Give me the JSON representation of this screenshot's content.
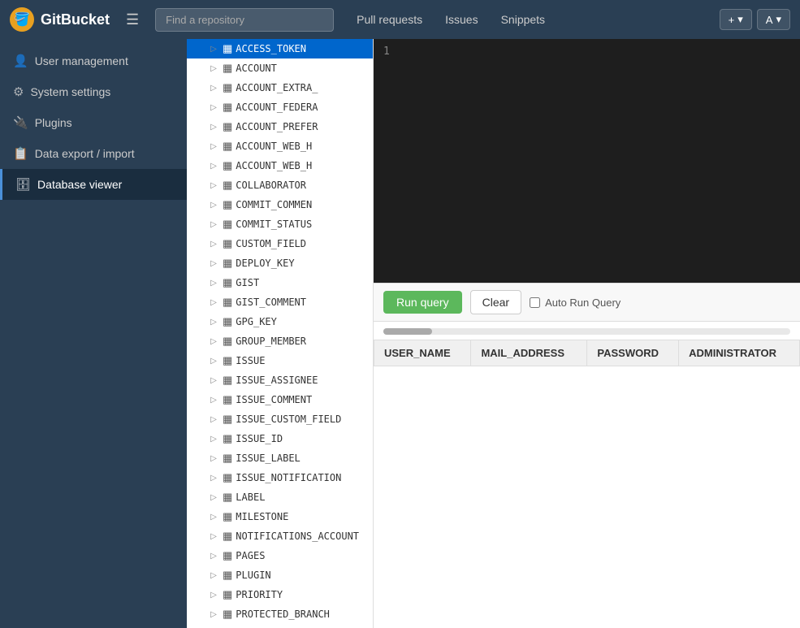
{
  "navbar": {
    "brand": "GitBucket",
    "brand_icon": "🪣",
    "search_placeholder": "Find a repository",
    "links": [
      "Pull requests",
      "Issues",
      "Snippets"
    ],
    "action_new_label": "+",
    "action_user_label": "A"
  },
  "sidebar": {
    "items": [
      {
        "id": "user-management",
        "icon": "👤",
        "label": "User management",
        "active": false
      },
      {
        "id": "system-settings",
        "icon": "⚙",
        "label": "System settings",
        "active": false
      },
      {
        "id": "plugins",
        "icon": "🔌",
        "label": "Plugins",
        "active": false
      },
      {
        "id": "data-export",
        "icon": "📋",
        "label": "Data export / import",
        "active": false
      },
      {
        "id": "database-viewer",
        "icon": "🗄",
        "label": "Database viewer",
        "active": true
      }
    ]
  },
  "tree": {
    "items": [
      {
        "label": "ACCESS_TOKEN",
        "selected": true
      },
      {
        "label": "ACCOUNT",
        "selected": false
      },
      {
        "label": "ACCOUNT_EXTRA_",
        "selected": false
      },
      {
        "label": "ACCOUNT_FEDERA",
        "selected": false
      },
      {
        "label": "ACCOUNT_PREFER",
        "selected": false
      },
      {
        "label": "ACCOUNT_WEB_H",
        "selected": false
      },
      {
        "label": "ACCOUNT_WEB_H",
        "selected": false
      },
      {
        "label": "COLLABORATOR",
        "selected": false
      },
      {
        "label": "COMMIT_COMMEN",
        "selected": false
      },
      {
        "label": "COMMIT_STATUS",
        "selected": false
      },
      {
        "label": "CUSTOM_FIELD",
        "selected": false
      },
      {
        "label": "DEPLOY_KEY",
        "selected": false
      },
      {
        "label": "GIST",
        "selected": false
      },
      {
        "label": "GIST_COMMENT",
        "selected": false
      },
      {
        "label": "GPG_KEY",
        "selected": false
      },
      {
        "label": "GROUP_MEMBER",
        "selected": false
      },
      {
        "label": "ISSUE",
        "selected": false
      },
      {
        "label": "ISSUE_ASSIGNEE",
        "selected": false
      },
      {
        "label": "ISSUE_COMMENT",
        "selected": false
      },
      {
        "label": "ISSUE_CUSTOM_FIELD",
        "selected": false
      },
      {
        "label": "ISSUE_ID",
        "selected": false
      },
      {
        "label": "ISSUE_LABEL",
        "selected": false
      },
      {
        "label": "ISSUE_NOTIFICATION",
        "selected": false
      },
      {
        "label": "LABEL",
        "selected": false
      },
      {
        "label": "MILESTONE",
        "selected": false
      },
      {
        "label": "NOTIFICATIONS_ACCOUNT",
        "selected": false
      },
      {
        "label": "PAGES",
        "selected": false
      },
      {
        "label": "PLUGIN",
        "selected": false
      },
      {
        "label": "PRIORITY",
        "selected": false
      },
      {
        "label": "PROTECTED_BRANCH",
        "selected": false
      }
    ]
  },
  "query_editor": {
    "line_number": "1"
  },
  "toolbar": {
    "run_label": "Run query",
    "clear_label": "Clear",
    "auto_run_label": "Auto Run Query"
  },
  "results": {
    "columns": [
      "USER_NAME",
      "MAIL_ADDRESS",
      "PASSWORD",
      "ADMINISTRATOR"
    ],
    "rows": []
  }
}
